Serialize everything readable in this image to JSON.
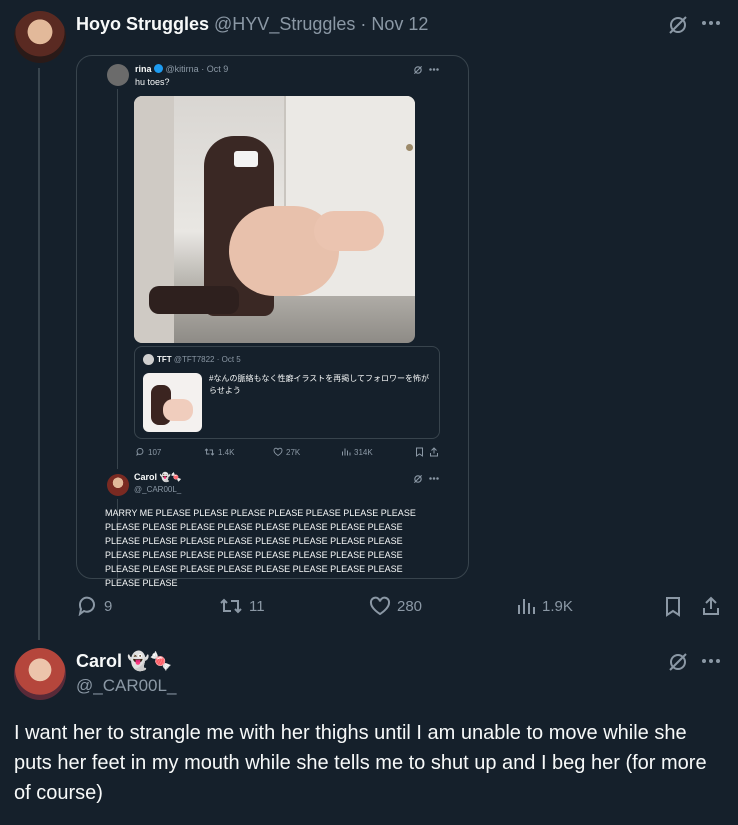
{
  "main_post": {
    "display_name": "Hoyo Struggles",
    "handle": "@HYV_Struggles",
    "separator": "·",
    "date": "Nov 12",
    "stats": {
      "replies": "9",
      "reposts": "11",
      "likes": "280",
      "views": "1.9K"
    }
  },
  "quoted_post": {
    "display_name": "rina",
    "handle": "@kitirna",
    "separator": "·",
    "date": "Oct 9",
    "text": "hu toes?",
    "nested_quote": {
      "display_name": "TFT",
      "handle": "@TFT7822",
      "separator": "·",
      "date": "Oct 5",
      "text": "#なんの脈絡もなく性癖イラストを再掲してフォロワーを怖がらせよう"
    },
    "stats": {
      "replies": "107",
      "reposts": "1.4K",
      "likes": "27K",
      "views": "314K"
    }
  },
  "quoted_reply": {
    "display_name": "Carol",
    "emoji": "👻🍬",
    "handle": "@_CAR00L_",
    "text": "MARRY ME PLEASE PLEASE PLEASE PLEASE PLEASE PLEASE PLEASE PLEASE PLEASE PLEASE PLEASE PLEASE PLEASE PLEASE PLEASE PLEASE PLEASE PLEASE PLEASE PLEASE PLEASE PLEASE PLEASE PLEASE PLEASE PLEASE PLEASE PLEASE PLEASE PLEASE PLEASE PLEASE PLEASE PLEASE PLEASE PLEASE PLEASE PLEASE PLEASE PLEASE PLEASE"
  },
  "reply_post": {
    "display_name": "Carol",
    "emoji": "👻🍬",
    "handle": "@_CAR00L_",
    "text": "I want her to strangle me with her thighs until I am unable to move while she puts her feet in my mouth while she tells me to shut up and I beg her (for more of course)"
  },
  "colors": {
    "background": "#15202b",
    "border": "#38444d",
    "muted": "#8b98a5",
    "verified": "#1d9bf0"
  }
}
